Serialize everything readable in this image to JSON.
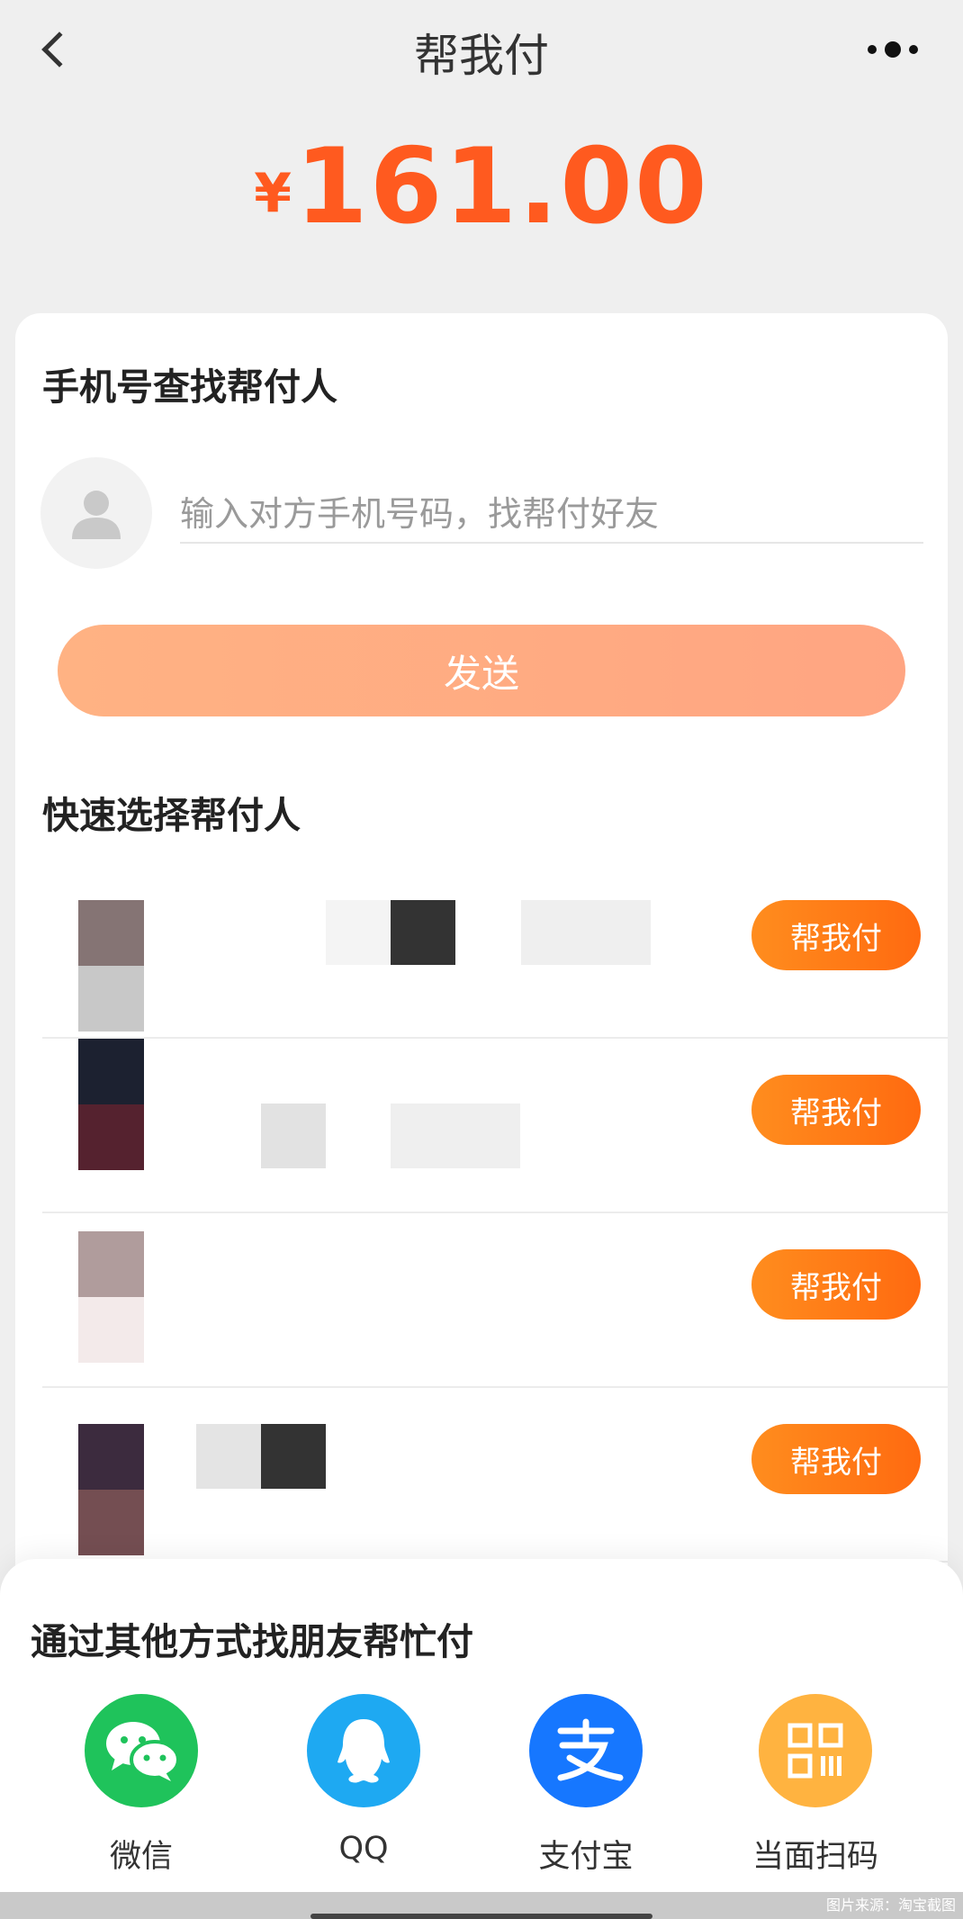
{
  "header": {
    "title": "帮我付"
  },
  "amount": {
    "currency": "¥",
    "value": "161.00"
  },
  "phone_search": {
    "title": "手机号查找帮付人",
    "placeholder": "输入对方手机号码，找帮付好友",
    "send_label": "发送"
  },
  "quick_select": {
    "title": "快速选择帮付人",
    "pay_button_label": "帮我付",
    "rows": [
      {
        "pay_label": "帮我付"
      },
      {
        "pay_label": "帮我付"
      },
      {
        "pay_label": "帮我付"
      },
      {
        "pay_label": "帮我付"
      }
    ]
  },
  "other_ways": {
    "title": "通过其他方式找朋友帮忙付",
    "options": [
      {
        "label": "微信",
        "icon": "wechat-icon",
        "color": "#1fc35b"
      },
      {
        "label": "QQ",
        "icon": "qq-icon",
        "color": "#1ea9f2"
      },
      {
        "label": "支付宝",
        "icon": "alipay-icon",
        "color": "#1677ff"
      },
      {
        "label": "当面扫码",
        "icon": "qrcode-icon",
        "color": "#ffb340"
      }
    ]
  },
  "watermark": "图片来源：淘宝截图",
  "colors": {
    "accent": "#ff5a1f",
    "pay_button": "#ff7a14",
    "send_button": "#ffad85"
  }
}
